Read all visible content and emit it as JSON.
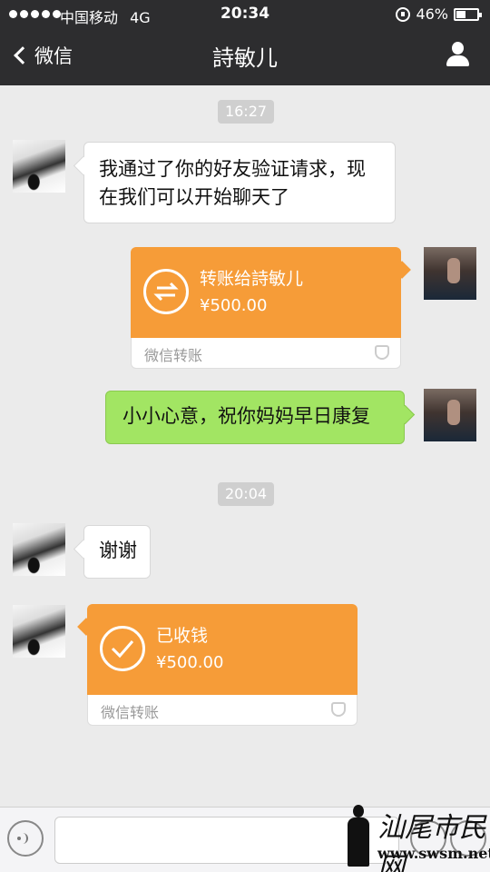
{
  "status_bar": {
    "carrier": "中国移动",
    "network": "4G",
    "time": "20:34",
    "battery_percent": "46%",
    "battery_level": 0.46
  },
  "nav": {
    "back_label": "微信",
    "title": "詩敏儿"
  },
  "chat": {
    "timestamp_1": "16:27",
    "msg_friend_accept": "我通过了你的好友验证请求，现在我们可以开始聊天了",
    "transfer_sent": {
      "title": "转账给詩敏儿",
      "amount": "¥500.00",
      "footer": "微信转账"
    },
    "msg_sent_text": "小小心意，祝你妈妈早日康复",
    "timestamp_2": "20:04",
    "msg_thanks": "谢谢",
    "transfer_received": {
      "title": "已收钱",
      "amount": "¥500.00",
      "footer": "微信转账"
    }
  },
  "watermark": {
    "text": "汕尾市民网",
    "url": "www.swsm.net"
  },
  "colors": {
    "nav_bg": "#2d2d2f",
    "chat_bg": "#ebebeb",
    "green_bubble": "#a2e563",
    "transfer_orange": "#f69c38"
  },
  "icons": [
    "back-chevron-icon",
    "profile-icon",
    "transfer-arrows-icon",
    "check-circle-icon",
    "shield-icon",
    "voice-icon",
    "emoji-icon",
    "plus-icon"
  ]
}
